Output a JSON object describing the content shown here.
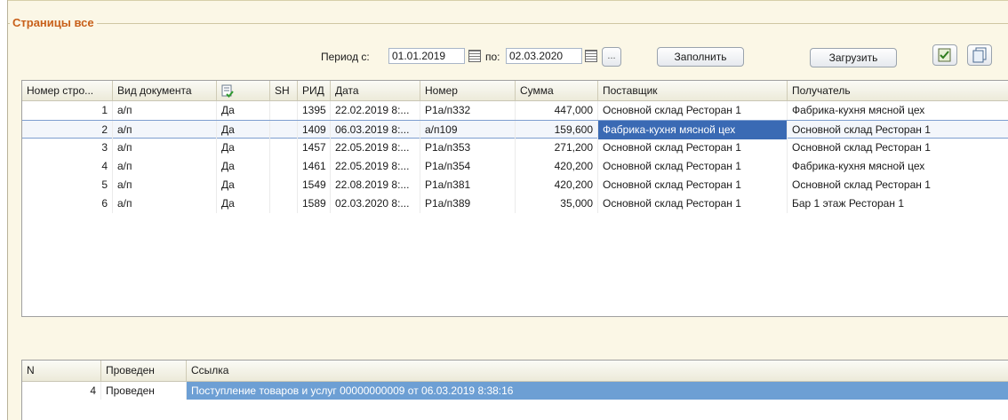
{
  "group": {
    "title": "Страницы все"
  },
  "filter": {
    "period_from_label": "Период с:",
    "period_from": "01.01.2019",
    "period_to_label": "по:",
    "period_to": "02.03.2020",
    "ellipsis": "...",
    "fill_button": "Заполнить",
    "load_button": "Загрузить"
  },
  "main_table": {
    "columns": [
      "Номер стро...",
      "Вид документа",
      "",
      "SH",
      "РИД",
      "Дата",
      "Номер",
      "Сумма",
      "Поставщик",
      "Получатель"
    ],
    "rows": [
      [
        "1",
        "а/п",
        "Да",
        "",
        "1395",
        "22.02.2019 8:...",
        "Р1а/п332",
        "447,000",
        "Основной склад Ресторан 1",
        "Фабрика-кухня мясной цех"
      ],
      [
        "2",
        "а/п",
        "Да",
        "",
        "1409",
        "06.03.2019 8:...",
        "а/п109",
        "159,600",
        "Фабрика-кухня мясной цех",
        "Основной склад Ресторан 1"
      ],
      [
        "3",
        "а/п",
        "Да",
        "",
        "1457",
        "22.05.2019 8:...",
        "Р1а/п353",
        "271,200",
        "Основной склад Ресторан 1",
        "Основной склад Ресторан 1"
      ],
      [
        "4",
        "а/п",
        "Да",
        "",
        "1461",
        "22.05.2019 8:...",
        "Р1а/п354",
        "420,200",
        "Основной склад Ресторан 1",
        "Фабрика-кухня мясной цех"
      ],
      [
        "5",
        "а/п",
        "Да",
        "",
        "1549",
        "22.08.2019 8:...",
        "Р1а/п381",
        "420,200",
        "Основной склад Ресторан 1",
        "Основной склад Ресторан 1"
      ],
      [
        "6",
        "а/п",
        "Да",
        "",
        "1589",
        "02.03.2020 8:...",
        "Р1а/п389",
        "35,000",
        "Основной склад Ресторан 1",
        "Бар 1 этаж Ресторан 1"
      ]
    ]
  },
  "bottom_table": {
    "columns": [
      "N",
      "Проведен",
      "Ссылка"
    ],
    "rows": [
      [
        "4",
        "Проведен",
        "Поступление товаров и услуг 00000000009 от 06.03.2019 8:38:16"
      ]
    ]
  },
  "colors": {
    "accent_title": "#c8601a",
    "selection": "#3a6ab4",
    "bottom_selection": "#6d9fd4"
  },
  "icons": [
    "calendar-icon",
    "doc-check-icon",
    "check-list-icon",
    "copy-icon"
  ]
}
